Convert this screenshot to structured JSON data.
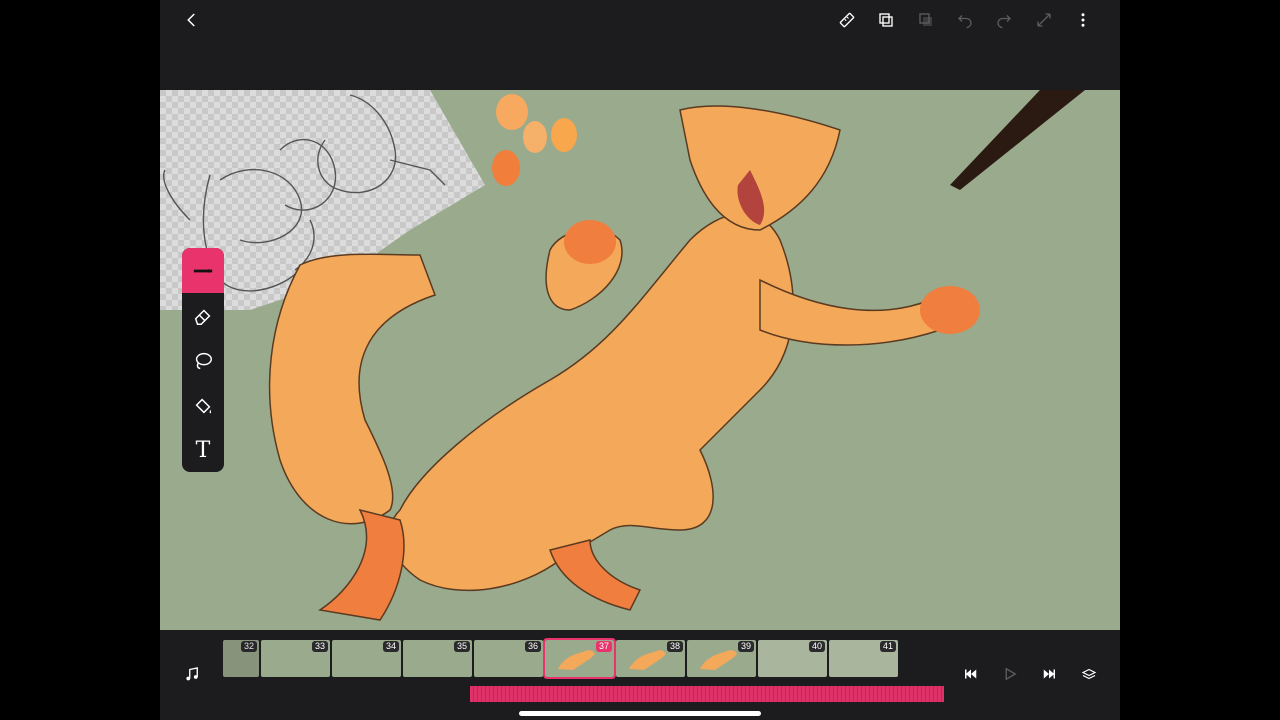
{
  "topbar": {
    "icons": [
      "chevron-left-icon",
      "ruler-icon",
      "layers-copy-icon",
      "layers-icon",
      "undo-icon",
      "redo-icon",
      "resize-icon",
      "more-vertical-icon"
    ]
  },
  "toolbox": {
    "tools": [
      "brush-icon",
      "eraser-icon",
      "lasso-icon",
      "fill-bucket-icon",
      "text-icon"
    ],
    "active": "brush-icon",
    "text_tool_glyph": "T"
  },
  "timeline": {
    "frames": [
      {
        "number": "32",
        "kind": "blank"
      },
      {
        "number": "33",
        "kind": "blank"
      },
      {
        "number": "34",
        "kind": "blank"
      },
      {
        "number": "35",
        "kind": "blank"
      },
      {
        "number": "36",
        "kind": "blank"
      },
      {
        "number": "37",
        "kind": "drawn",
        "current": true
      },
      {
        "number": "38",
        "kind": "drawn"
      },
      {
        "number": "39",
        "kind": "drawn"
      },
      {
        "number": "40",
        "kind": "sketch"
      },
      {
        "number": "41",
        "kind": "sketch"
      }
    ],
    "controls": [
      "music-icon",
      "skip-back-icon",
      "play-icon",
      "skip-forward-icon",
      "layers-stack-icon"
    ]
  },
  "colors": {
    "accent": "#e8336d",
    "canvas": "#9aaa8c",
    "chrome": "#1c1c1e",
    "fur": "#f4a85a",
    "fur_dark": "#f07e3e",
    "swatches": [
      "#f7a95f",
      "#f5b06a",
      "#f8a74c",
      "#f17e3a"
    ]
  }
}
